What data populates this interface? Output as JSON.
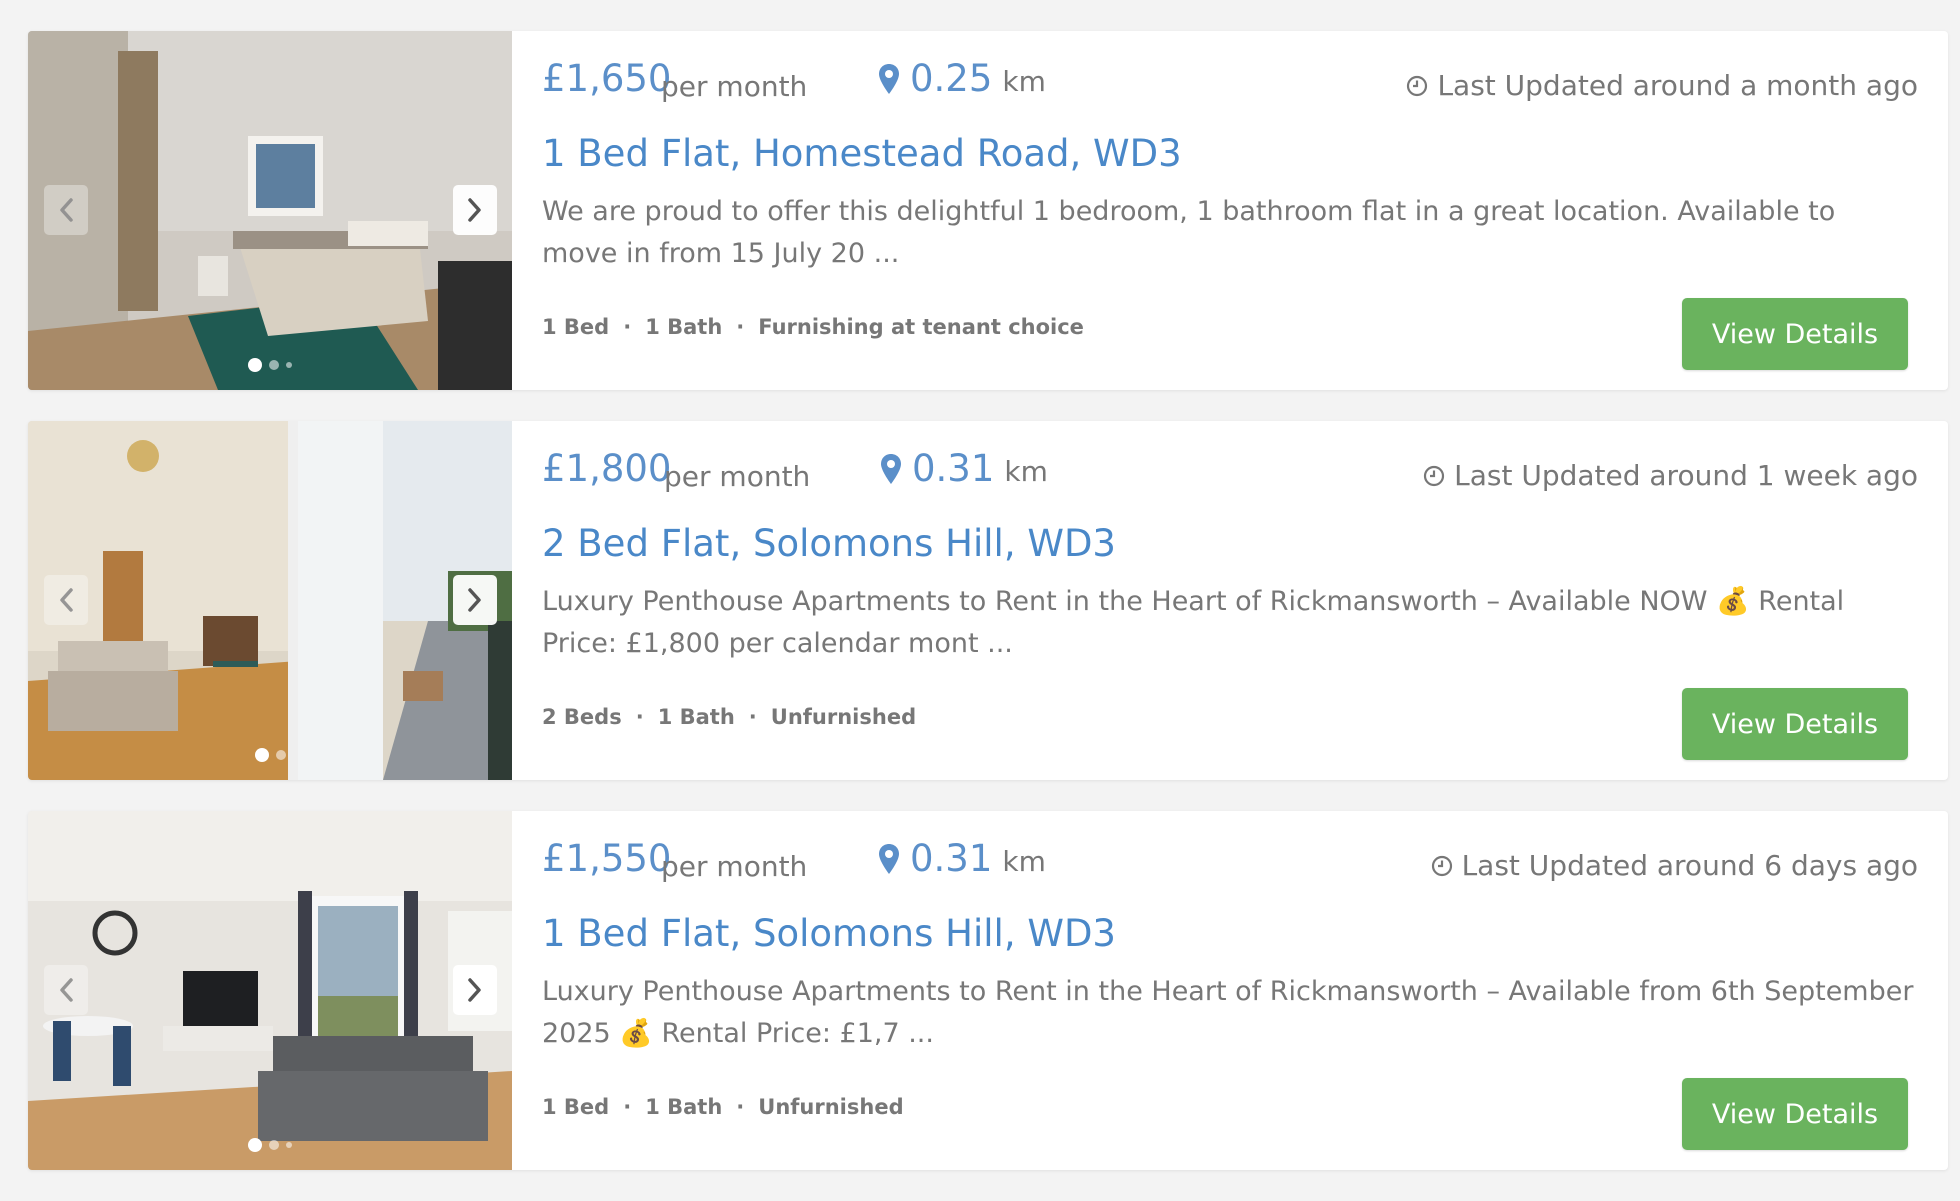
{
  "listings": [
    {
      "price": "£1,650",
      "per": "per month",
      "distance": "0.25",
      "unit": "km",
      "updated": "Last Updated around a month ago",
      "title": "1 Bed Flat, Homestead Road, WD3",
      "description": "We are proud to offer this delightful 1 bedroom, 1 bathroom flat in a great location. Available to move in from 15 July 20 ...",
      "beds": "1 Bed",
      "baths": "1 Bath",
      "furnishing": "Furnishing at tenant choice",
      "button": "View Details"
    },
    {
      "price": "£1,800",
      "per": "per month",
      "distance": "0.31",
      "unit": "km",
      "updated": "Last Updated around 1 week ago",
      "title": "2 Bed Flat, Solomons Hill, WD3",
      "description": "Luxury Penthouse Apartments to Rent in the Heart of Rickmansworth – Available NOW 💰 Rental Price: £1,800 per calendar mont ...",
      "beds": "2 Beds",
      "baths": "1 Bath",
      "furnishing": "Unfurnished",
      "button": "View Details"
    },
    {
      "price": "£1,550",
      "per": "per month",
      "distance": "0.31",
      "unit": "km",
      "updated": "Last Updated around 6 days ago",
      "title": "1 Bed Flat, Solomons Hill, WD3",
      "description": "Luxury Penthouse Apartments to Rent in the Heart of Rickmansworth – Available from 6th September 2025 💰 Rental Price: £1,7 ...",
      "beds": "1 Bed",
      "baths": "1 Bath",
      "furnishing": "Unfurnished",
      "button": "View Details"
    }
  ],
  "icons": {
    "prev": "chevron-left-icon",
    "next": "chevron-right-icon",
    "pin": "map-pin-icon",
    "clock": "clock-icon"
  },
  "colors": {
    "accent": "#4a88c8",
    "button": "#6ab35e",
    "text": "#777777",
    "background": "#f3f3f3"
  }
}
